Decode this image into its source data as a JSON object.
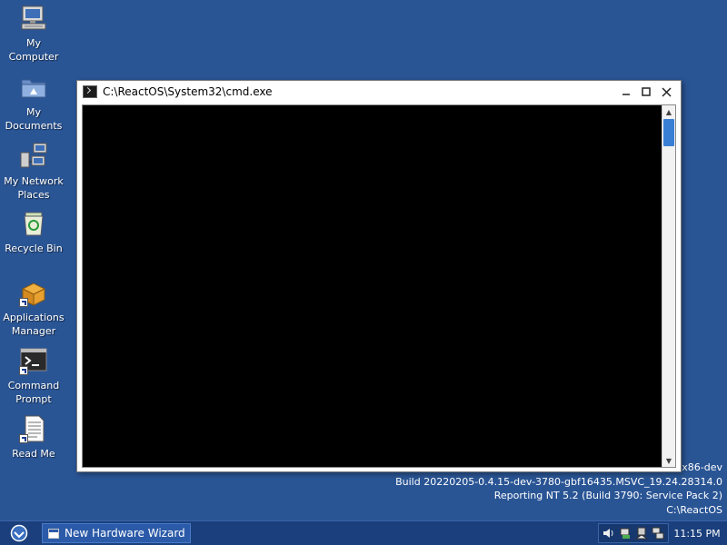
{
  "desktop": {
    "icons": [
      {
        "label_line1": "My",
        "label_line2": "Computer",
        "icon": "computer-icon"
      },
      {
        "label_line1": "My",
        "label_line2": "Documents",
        "icon": "folder-icon"
      },
      {
        "label_line1": "My Network",
        "label_line2": "Places",
        "icon": "network-icon"
      },
      {
        "label_line1": "Recycle Bin",
        "label_line2": "",
        "icon": "recycle-bin-icon"
      },
      {
        "label_line1": "Applications",
        "label_line2": "Manager",
        "icon": "applications-manager-icon"
      },
      {
        "label_line1": "Command",
        "label_line2": "Prompt",
        "icon": "command-prompt-icon"
      },
      {
        "label_line1": "Read Me",
        "label_line2": "",
        "icon": "document-icon"
      }
    ]
  },
  "window": {
    "title": "C:\\ReactOS\\System32\\cmd.exe",
    "icon": "console-icon"
  },
  "build_info": {
    "line1": "-x86-dev",
    "line2": "Build 20220205-0.4.15-dev-3780-gbf16435.MSVC_19.24.28314.0",
    "line3": "Reporting NT 5.2 (Build 3790: Service Pack 2)",
    "line4": "C:\\ReactOS"
  },
  "taskbar": {
    "task_label": "New Hardware Wizard",
    "clock": "11:15 PM",
    "tray_icons": [
      "volume-icon",
      "network-tray-icon",
      "safely-remove-icon",
      "network-connection-icon"
    ]
  },
  "colors": {
    "desktop": "#2a5595",
    "taskbar": "#1a3f7c",
    "console": "#000000",
    "scroll_thumb": "#3a7fd6"
  }
}
